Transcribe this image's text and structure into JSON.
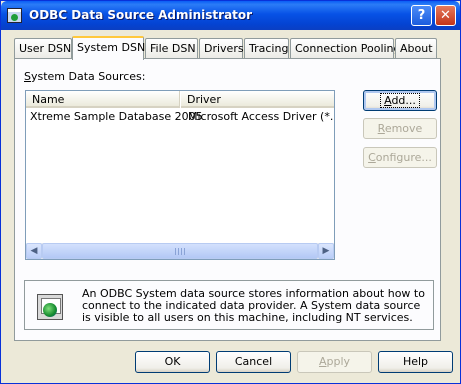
{
  "window": {
    "title": "ODBC Data Source Administrator",
    "help_label": "?",
    "close_label": "✕"
  },
  "tabs": [
    {
      "label": "User DSN"
    },
    {
      "label": "System DSN",
      "active": true
    },
    {
      "label": "File DSN"
    },
    {
      "label": "Drivers"
    },
    {
      "label": "Tracing"
    },
    {
      "label": "Connection Pooling"
    },
    {
      "label": "About"
    }
  ],
  "system_dsn": {
    "section_label_prefix": "S",
    "section_label_rest": "ystem Data Sources:",
    "columns": [
      "Name",
      "Driver"
    ],
    "rows": [
      {
        "name": "Xtreme Sample Database 2005",
        "driver": "Microsoft Access Driver (*.mdb)"
      }
    ],
    "buttons": {
      "add_prefix": "A",
      "add_rest": "dd...",
      "remove_prefix": "R",
      "remove_rest": "emove",
      "configure_prefix": "C",
      "configure_rest": "onfigure..."
    },
    "info_text": "An ODBC System data source stores information about how to connect to the indicated data provider.  A System data source is visible to all users on this machine, including NT services."
  },
  "icons": {
    "info": "odbc-globe-icon",
    "title": "odbc-app-icon",
    "grip": "scroll-grip-icon"
  },
  "footer": {
    "ok": "OK",
    "cancel": "Cancel",
    "apply_prefix": "A",
    "apply_rest": "pply",
    "help": "Help"
  }
}
